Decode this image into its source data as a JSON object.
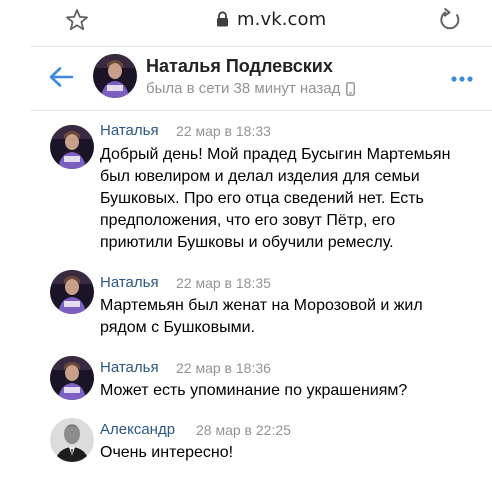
{
  "browser": {
    "url": "m.vk.com"
  },
  "header": {
    "name": "Наталья Подлевских",
    "status": "была в сети 38 минут назад"
  },
  "messages": [
    {
      "author": "Наталья",
      "time": "22 мар в 18:33",
      "lines": [
        "Добрый день! Мой прадед Бусыгин Мартемьян",
        "был ювелиром и делал изделия для семьи",
        "Бушковых. Про его отца сведений нет. Есть",
        "предположения, что его зовут Пётр, его",
        "приютили Бушковы и обучили ремеслу."
      ]
    },
    {
      "author": "Наталья",
      "time": "22 мар в 18:35",
      "lines": [
        "Мартемьян был женат на Морозовой и жил",
        "рядом с Бушковыми."
      ]
    },
    {
      "author": "Наталья",
      "time": "22 мар в 18:36",
      "lines": [
        "Может есть упоминание по украшениям?"
      ]
    },
    {
      "author": "Александр",
      "time": "28 мар в 22:25",
      "lines": [
        "Очень интересно!"
      ]
    }
  ],
  "colors": {
    "accent": "#3f8ae0",
    "author_link": "#2a5885",
    "secondary_text": "#939393"
  },
  "icons": {
    "star": "star-icon",
    "lock": "lock-icon",
    "reload": "reload-icon",
    "back": "back-arrow-icon",
    "more": "more-dots-icon",
    "phone": "mobile-phone-icon"
  }
}
